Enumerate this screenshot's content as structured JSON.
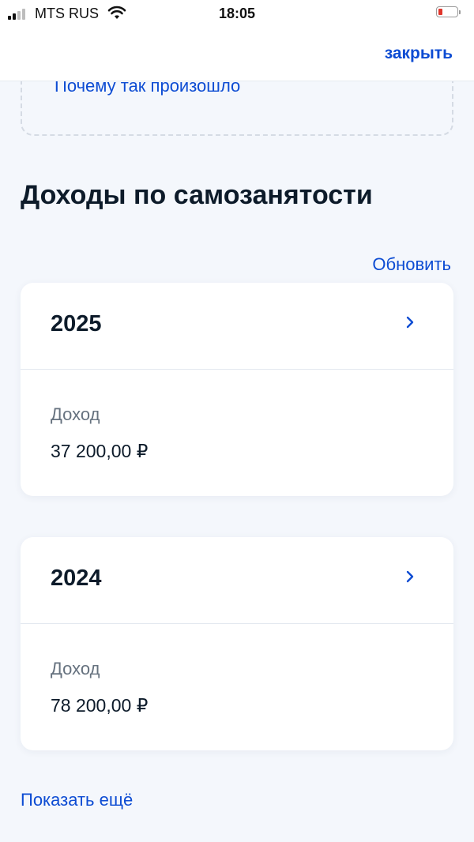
{
  "status_bar": {
    "carrier": "MTS RUS",
    "time": "18:05",
    "battery_level": 0.1,
    "battery_color": "#e0352b"
  },
  "nav": {
    "close_label": "закрыть"
  },
  "why_link": "Почему так произошло",
  "section": {
    "title": "Доходы по самозанятости",
    "refresh_label": "Обновить"
  },
  "years": [
    {
      "year": "2025",
      "income_label": "Доход",
      "income_value": "37 200,00 ₽"
    },
    {
      "year": "2024",
      "income_label": "Доход",
      "income_value": "78 200,00 ₽"
    }
  ],
  "show_more_label": "Показать ещё",
  "colors": {
    "accent": "#0d4cd3",
    "background": "#f4f7fc",
    "card": "#ffffff",
    "text": "#0d1b2a",
    "muted": "#66727f"
  },
  "icons": [
    "signal-icon",
    "wifi-icon",
    "battery-icon",
    "chevron-right-icon"
  ]
}
